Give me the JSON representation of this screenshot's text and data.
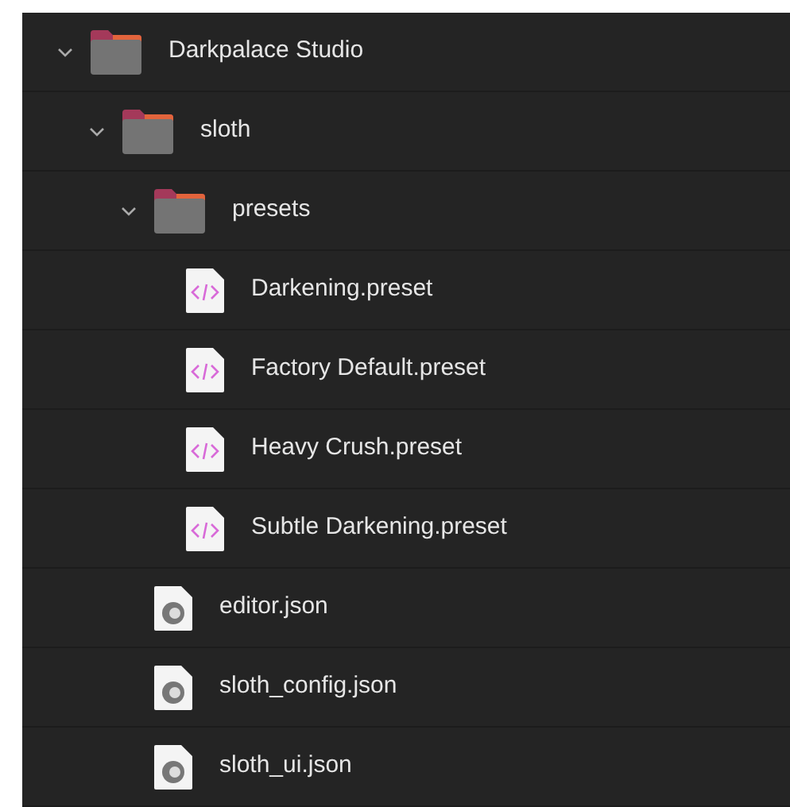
{
  "tree": [
    {
      "kind": "folder",
      "name": "Darkpalace Studio",
      "expanded": true,
      "children": [
        {
          "kind": "folder",
          "name": "sloth",
          "expanded": true,
          "children": [
            {
              "kind": "folder",
              "name": "presets",
              "expanded": true,
              "children": [
                {
                  "kind": "preset",
                  "name": "Darkening.preset"
                },
                {
                  "kind": "preset",
                  "name": "Factory Default.preset"
                },
                {
                  "kind": "preset",
                  "name": "Heavy Crush.preset"
                },
                {
                  "kind": "preset",
                  "name": "Subtle Darkening.preset"
                }
              ]
            },
            {
              "kind": "json",
              "name": "editor.json"
            },
            {
              "kind": "json",
              "name": "sloth_config.json"
            },
            {
              "kind": "json",
              "name": "sloth_ui.json"
            }
          ]
        }
      ]
    }
  ]
}
